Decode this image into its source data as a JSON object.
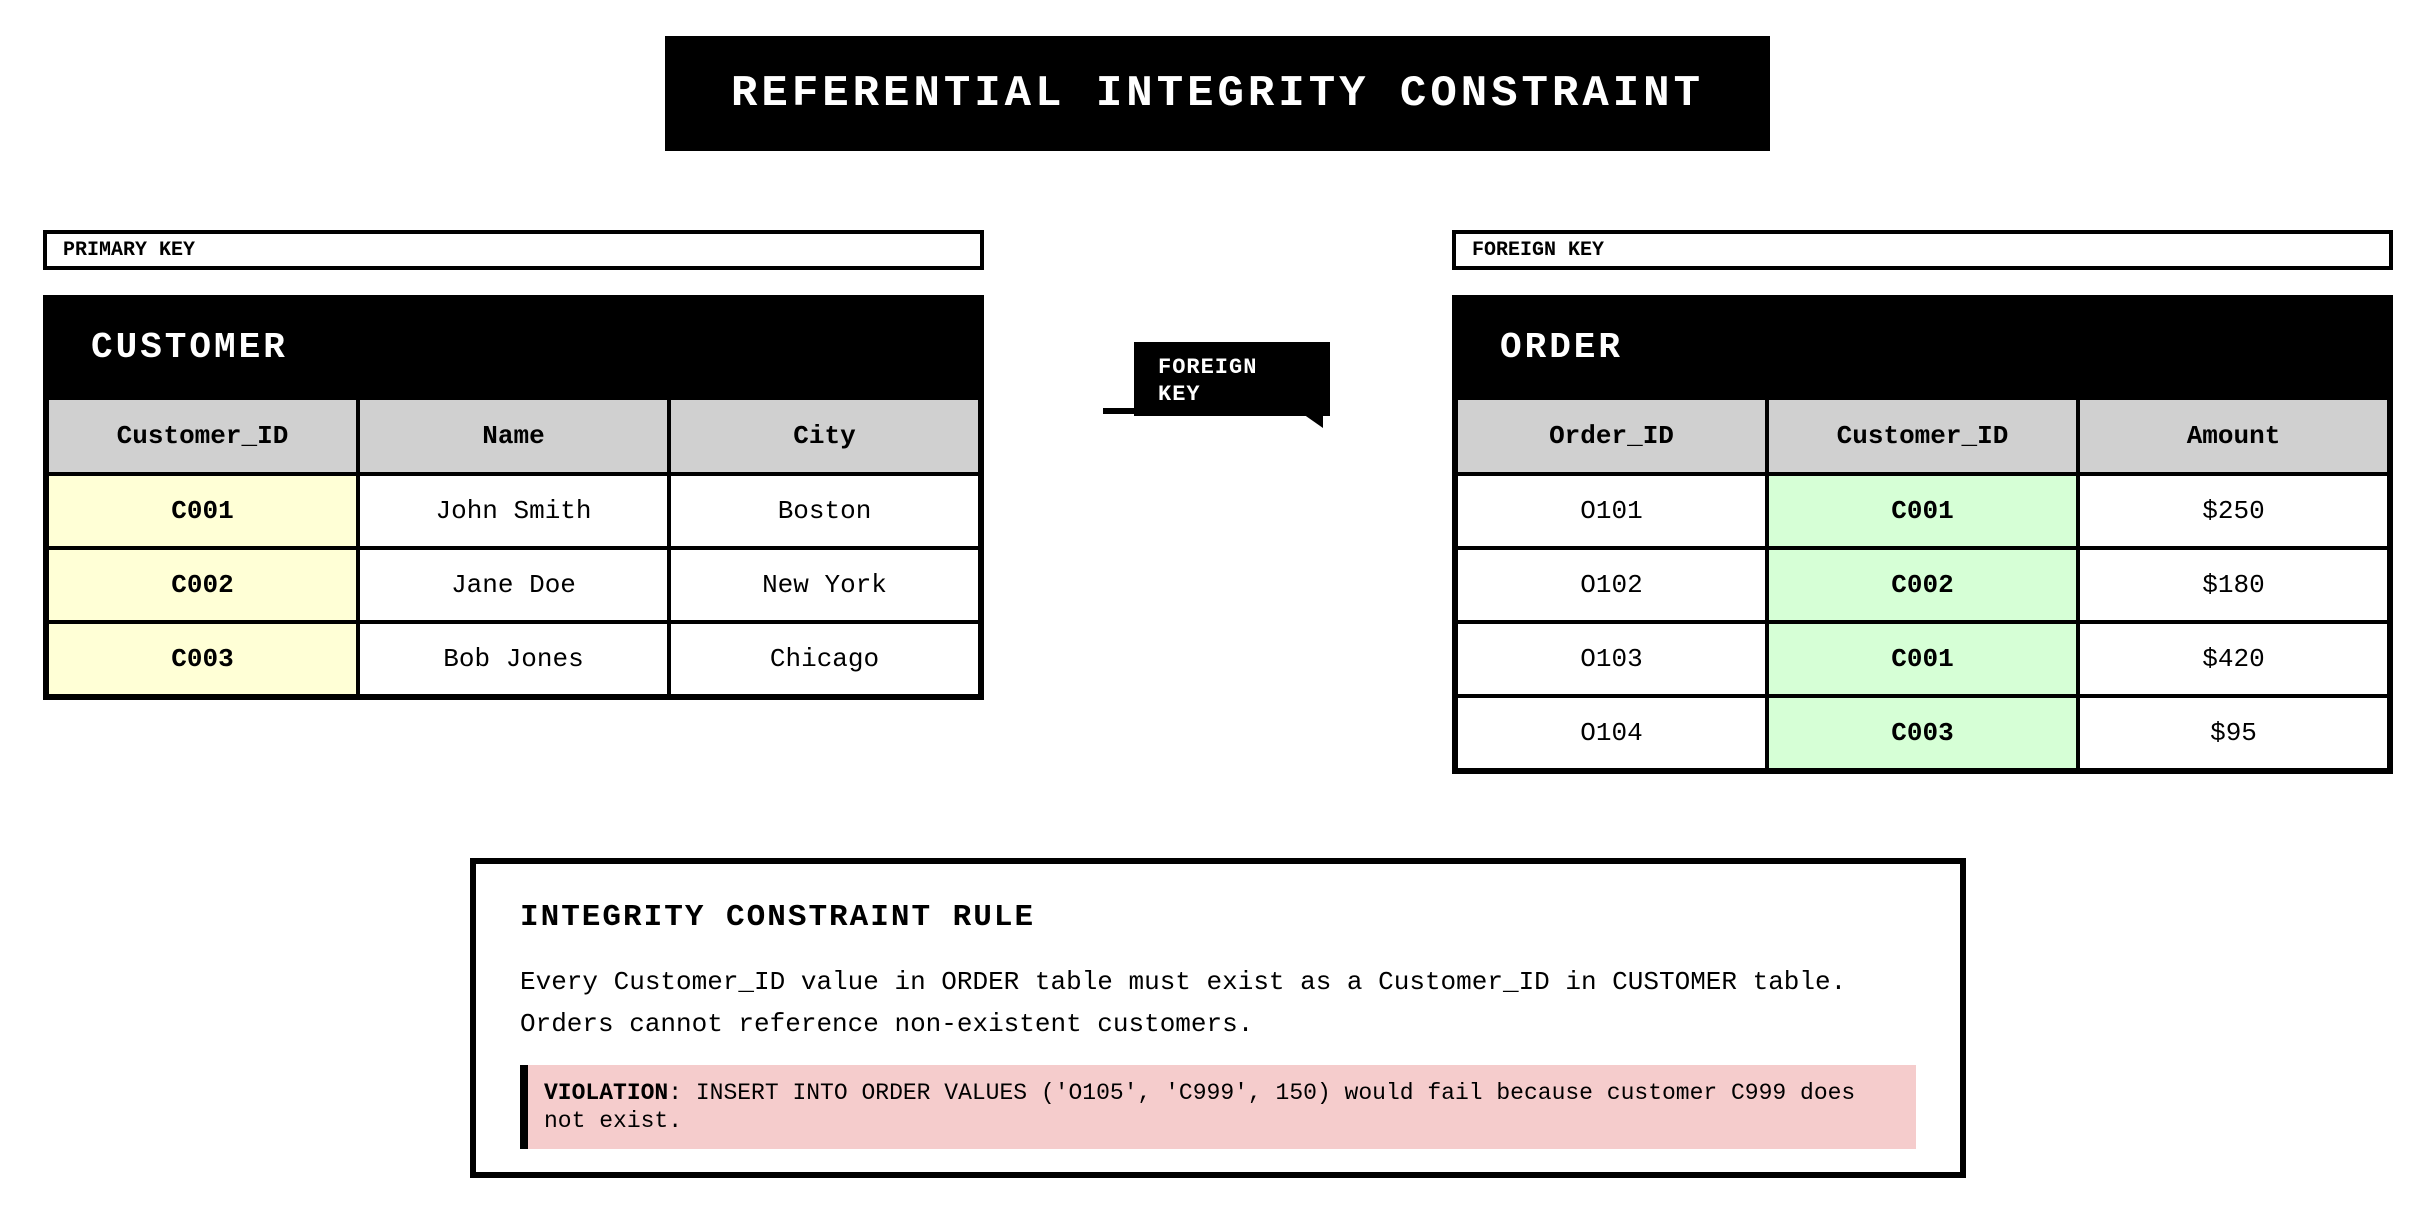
{
  "title": "REFERENTIAL INTEGRITY CONSTRAINT",
  "left_label": "PRIMARY KEY",
  "right_label": "FOREIGN KEY",
  "middle_tag": "FOREIGN\nKEY",
  "customer": {
    "name": "CUSTOMER",
    "headers": [
      "Customer_ID",
      "Name",
      "City"
    ],
    "rows": [
      [
        "C001",
        "John Smith",
        "Boston"
      ],
      [
        "C002",
        "Jane Doe",
        "New York"
      ],
      [
        "C003",
        "Bob Jones",
        "Chicago"
      ]
    ]
  },
  "order": {
    "name": "ORDER",
    "headers": [
      "Order_ID",
      "Customer_ID",
      "Amount"
    ],
    "rows": [
      [
        "O101",
        "C001",
        "$250"
      ],
      [
        "O102",
        "C002",
        "$180"
      ],
      [
        "O103",
        "C001",
        "$420"
      ],
      [
        "O104",
        "C003",
        "$95"
      ]
    ]
  },
  "rule": {
    "title": "INTEGRITY CONSTRAINT RULE",
    "line1": "Every Customer_ID value in ORDER table must exist as a Customer_ID in CUSTOMER table.",
    "line2": "Orders cannot reference non-existent customers.",
    "violation_label": "VIOLATION",
    "violation_text": ": INSERT INTO ORDER VALUES ('O105', 'C999', 150) would fail because customer C999 does not exist."
  },
  "colors": {
    "primary_key_fill": "#ffffd6",
    "foreign_key_fill": "#d6ffd6",
    "violation_fill": "#f5cccc",
    "header_fill": "#d0d0d0"
  }
}
